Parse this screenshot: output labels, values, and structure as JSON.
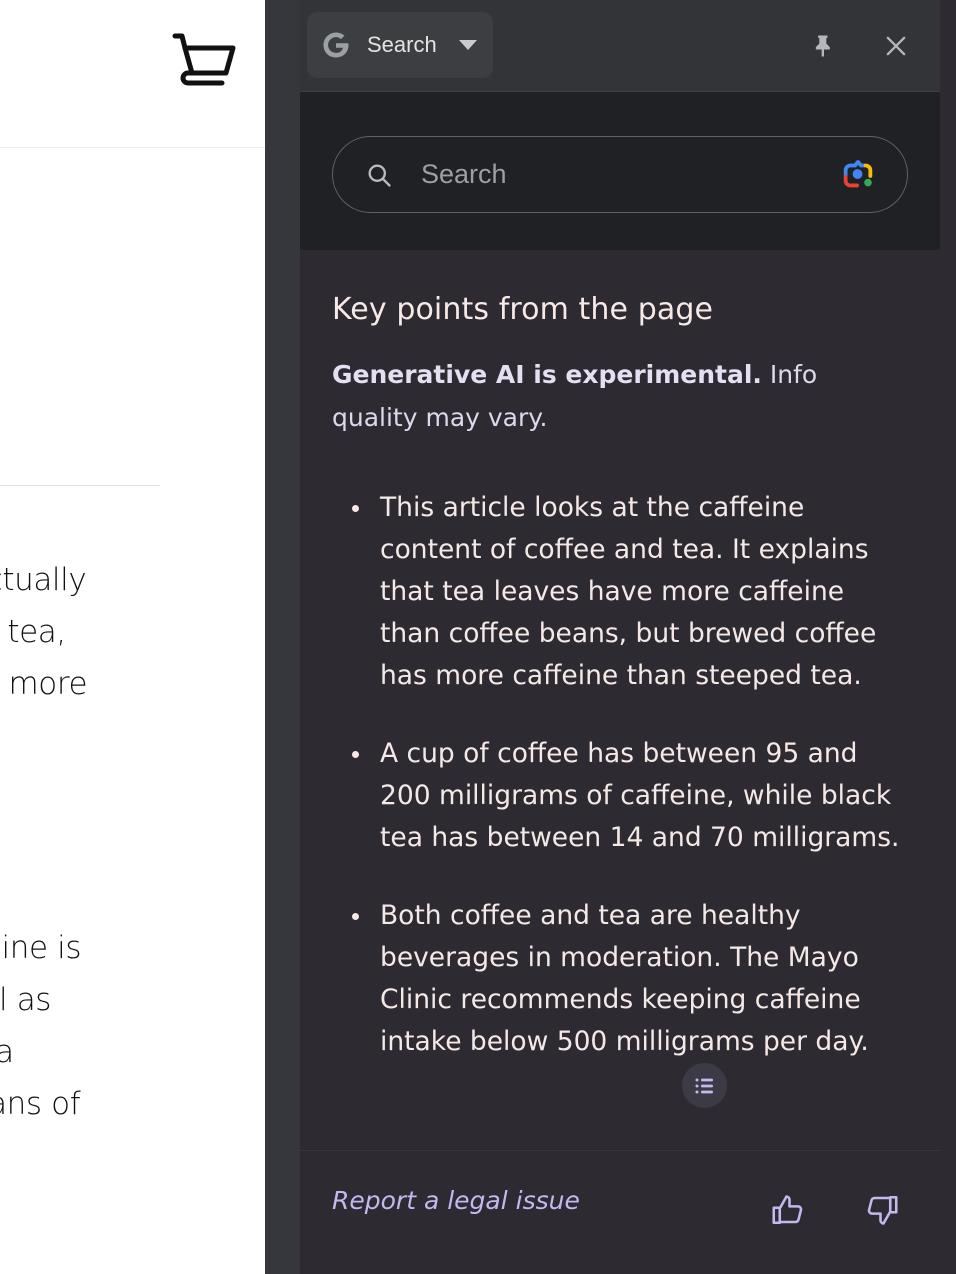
{
  "webpage": {
    "cart_icon": "shopping-cart-icon",
    "text_fragments": [
      "t's actually",
      "eped tea,",
      "ntain more",
      "Caffeine is",
      "s well as",
      "mellia",
      "e beans of"
    ]
  },
  "panel": {
    "header": {
      "tab_label": "Search",
      "brand_icon": "google-g-icon",
      "dropdown_icon": "chevron-down-icon",
      "pin_icon": "pin-icon",
      "close_icon": "close-icon"
    },
    "search": {
      "placeholder": "Search",
      "search_icon": "search-icon",
      "lens_icon": "google-lens-icon"
    },
    "content": {
      "title": "Key points from the page",
      "disclaimer_bold": "Generative AI is experimental.",
      "disclaimer_rest": " Info quality may vary.",
      "bullets": [
        "This article looks at the caffeine content of coffee and tea. It explains that tea leaves have more caffeine than coffee beans, but brewed coffee has more caffeine than steeped tea.",
        "A cup of coffee has between 95 and 200 milligrams of caffeine, while black tea has between 14 and 70 milligrams.",
        "Both coffee and tea are healthy beverages in moderation. The Mayo Clinic recommends keeping caffeine intake below 500 milligrams per day."
      ],
      "list_badge_icon": "list-view-icon"
    },
    "footer": {
      "legal_label": "Report a legal issue",
      "thumbs_up_icon": "thumbs-up-icon",
      "thumbs_down_icon": "thumbs-down-icon"
    },
    "resize_handle_icon": "drag-handle-icon"
  },
  "colors": {
    "panel_bg": "#2d2b31",
    "header_bg": "#323438",
    "search_bg": "#202124",
    "gutter_bg": "#35373c",
    "accent_lavender": "#c3b8ef",
    "text_warm_white": "#f5e9e8",
    "placeholder": "#9aa0a6",
    "lens_blue": "#4285f4",
    "lens_red": "#ea4335",
    "lens_yellow": "#fbbc04",
    "lens_green": "#34a853"
  }
}
